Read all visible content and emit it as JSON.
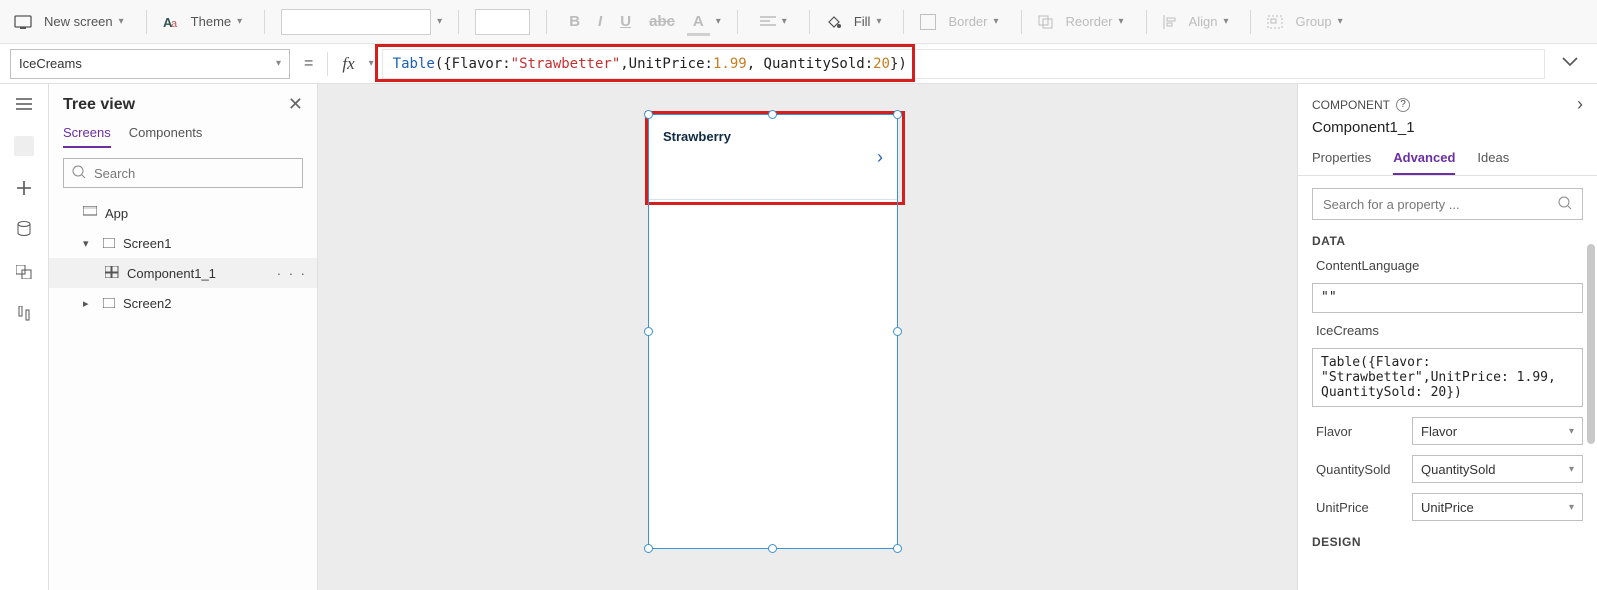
{
  "toolbar": {
    "new_screen": "New screen",
    "theme": "Theme",
    "fill": "Fill",
    "border": "Border",
    "reorder": "Reorder",
    "align": "Align",
    "group": "Group"
  },
  "formula_bar": {
    "property": "IceCreams",
    "formula_tokens": {
      "t1": "Table",
      "t2": "({Flavor: ",
      "t3": "\"Strawbetter\"",
      "t4": ",UnitPrice: ",
      "t5": "1.99",
      "t6": ", QuantitySold: ",
      "t7": "20",
      "t8": "})"
    }
  },
  "tree": {
    "title": "Tree view",
    "tabs": {
      "screens": "Screens",
      "components": "Components"
    },
    "search_placeholder": "Search",
    "app": "App",
    "nodes": {
      "screen1": "Screen1",
      "component1": "Component1_1",
      "screen2": "Screen2"
    }
  },
  "canvas": {
    "gallery_item_text": "Strawberry"
  },
  "props": {
    "header": "COMPONENT",
    "name": "Component1_1",
    "tabs": {
      "properties": "Properties",
      "advanced": "Advanced",
      "ideas": "Ideas"
    },
    "search_placeholder": "Search for a property ...",
    "sections": {
      "data": "DATA",
      "design": "DESIGN"
    },
    "content_language_label": "ContentLanguage",
    "content_language_value": "\"\"",
    "icecreams_label": "IceCreams",
    "icecreams_value": "Table({Flavor: \"Strawbetter\",UnitPrice: 1.99, QuantitySold: 20})",
    "pairs": {
      "flavor": {
        "label": "Flavor",
        "value": "Flavor"
      },
      "qty": {
        "label": "QuantitySold",
        "value": "QuantitySold"
      },
      "price": {
        "label": "UnitPrice",
        "value": "UnitPrice"
      }
    }
  }
}
